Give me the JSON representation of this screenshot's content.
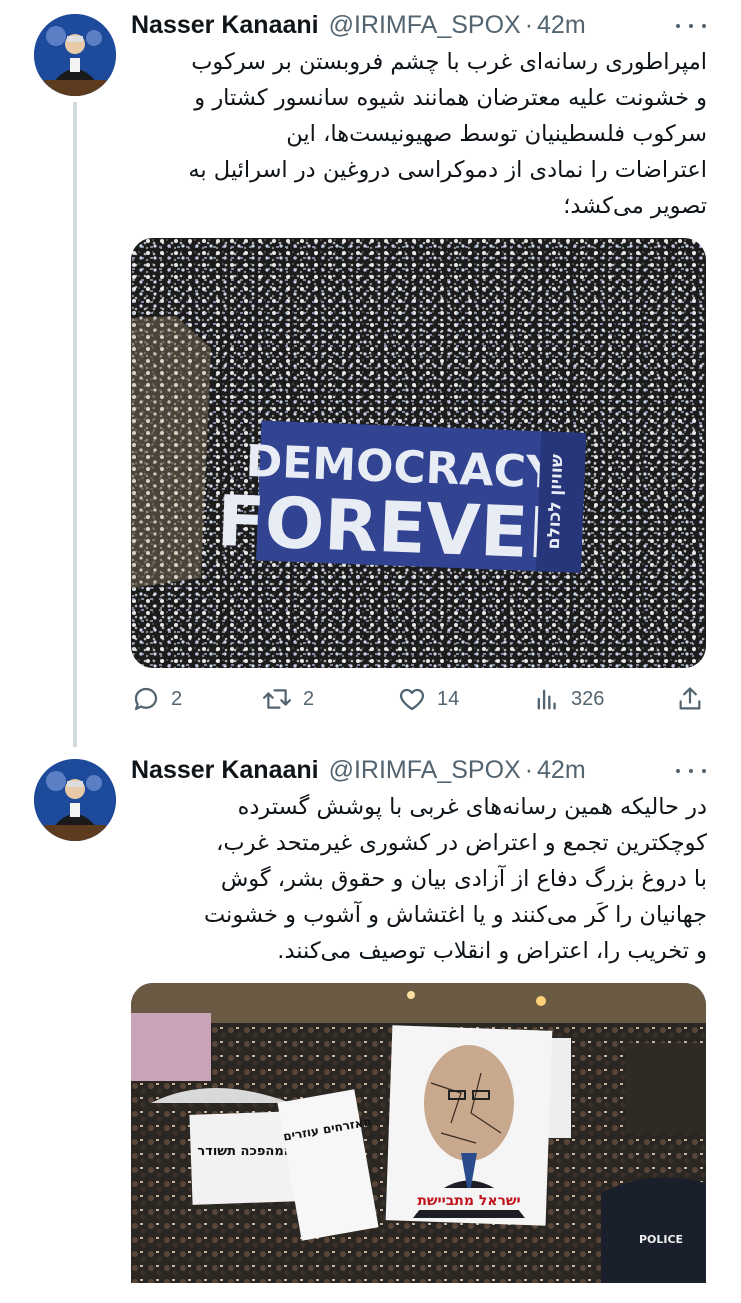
{
  "tweets": [
    {
      "author_name": "Nasser Kanaani",
      "handle": "@IRIMFA_SPOX",
      "separator": "·",
      "time": "42m",
      "text_lines": [
        "امپراطوری رسانه‌ای غرب با چشم فروبستن بر سرکوب",
        "و خشونت علیه معترضان همانند شیوه سانسور کشتار و",
        "سرکوب فلسطینیان توسط صهیونیست‌ها، این",
        "اعتراضات را نمادی از دموکراسی دروغین در اسرائیل به",
        "تصویر می‌کشد؛"
      ],
      "media": {
        "description_icon": "protest-crowd-photo",
        "banner_line1": "DEMOCRACY",
        "banner_line2": "FOREVER",
        "banner_hebrew": "שוויון לכולם"
      },
      "actions": {
        "replies": "2",
        "retweets": "2",
        "likes": "14",
        "views": "326"
      }
    },
    {
      "author_name": "Nasser Kanaani",
      "handle": "@IRIMFA_SPOX",
      "separator": "·",
      "time": "42m",
      "text_lines": [
        "در حالیکه همین رسانه‌های غربی با پوشش گسترده",
        "کوچکترین تجمع و اعتراض در کشوری غیرمتحد غرب،",
        "با دروغ بزرگ دفاع از آزادی بیان و حقوق بشر، گوش",
        "جهانیان را کَر می‌کنند و یا اغتشاش و آشوب و خشونت",
        "و تخریب را، اعتراض و انقلاب توصیف می‌کنند."
      ],
      "media": {
        "description_icon": "protest-signs-photo",
        "sign_left": "המהפכה תשודר",
        "sign_middle": "האזרחים עוזרים",
        "sign_caption": "ישראל מתביישת",
        "police_text": "POLICE"
      }
    }
  ],
  "colors": {
    "text_primary": "#0f1419",
    "text_secondary": "#536471",
    "thread_line": "#cfd9de",
    "banner_blue": "#2d3e8c"
  }
}
